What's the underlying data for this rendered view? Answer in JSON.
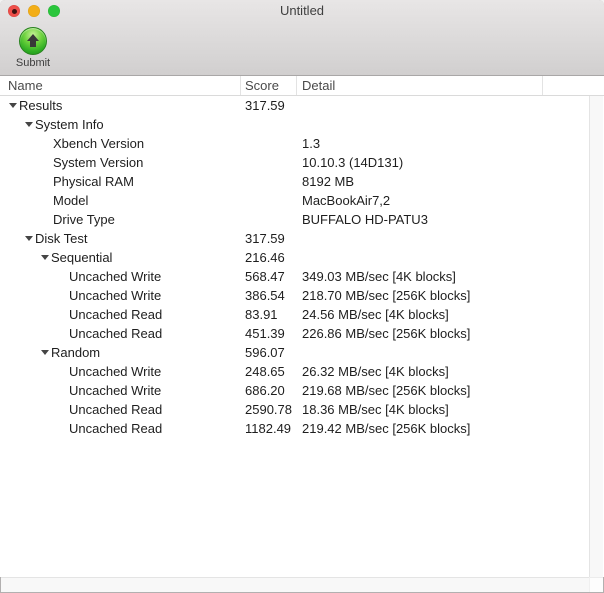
{
  "window": {
    "title": "Untitled",
    "icons": [
      "close-icon",
      "minimize-icon",
      "zoom-icon",
      "document-edited-dot",
      "submit-icon",
      "disclosure-triangle-icon"
    ]
  },
  "toolbar": {
    "submit_label": "Submit"
  },
  "table": {
    "columns": [
      {
        "label": "Name"
      },
      {
        "label": "Score"
      },
      {
        "label": "Detail"
      }
    ],
    "rows": [
      {
        "level": 0,
        "expandable": true,
        "name": "Results",
        "score": "317.59",
        "detail": ""
      },
      {
        "level": 1,
        "expandable": true,
        "name": "System Info",
        "score": "",
        "detail": ""
      },
      {
        "level": 2,
        "expandable": false,
        "name": "Xbench Version",
        "score": "",
        "detail": "1.3"
      },
      {
        "level": 2,
        "expandable": false,
        "name": "System Version",
        "score": "",
        "detail": "10.10.3 (14D131)"
      },
      {
        "level": 2,
        "expandable": false,
        "name": "Physical RAM",
        "score": "",
        "detail": "8192 MB"
      },
      {
        "level": 2,
        "expandable": false,
        "name": "Model",
        "score": "",
        "detail": "MacBookAir7,2"
      },
      {
        "level": 2,
        "expandable": false,
        "name": "Drive Type",
        "score": "",
        "detail": "BUFFALO HD-PATU3"
      },
      {
        "level": 1,
        "expandable": true,
        "name": "Disk Test",
        "score": "317.59",
        "detail": ""
      },
      {
        "level": 2,
        "expandable": true,
        "name": "Sequential",
        "score": "216.46",
        "detail": ""
      },
      {
        "level": 3,
        "expandable": false,
        "name": "Uncached Write",
        "score": "568.47",
        "detail": "349.03 MB/sec [4K blocks]"
      },
      {
        "level": 3,
        "expandable": false,
        "name": "Uncached Write",
        "score": "386.54",
        "detail": "218.70 MB/sec [256K blocks]"
      },
      {
        "level": 3,
        "expandable": false,
        "name": "Uncached Read",
        "score": "83.91",
        "detail": "24.56 MB/sec [4K blocks]"
      },
      {
        "level": 3,
        "expandable": false,
        "name": "Uncached Read",
        "score": "451.39",
        "detail": "226.86 MB/sec [256K blocks]"
      },
      {
        "level": 2,
        "expandable": true,
        "name": "Random",
        "score": "596.07",
        "detail": ""
      },
      {
        "level": 3,
        "expandable": false,
        "name": "Uncached Write",
        "score": "248.65",
        "detail": "26.32 MB/sec [4K blocks]"
      },
      {
        "level": 3,
        "expandable": false,
        "name": "Uncached Write",
        "score": "686.20",
        "detail": "219.68 MB/sec [256K blocks]"
      },
      {
        "level": 3,
        "expandable": false,
        "name": "Uncached Read",
        "score": "2590.78",
        "detail": "18.36 MB/sec [4K blocks]"
      },
      {
        "level": 3,
        "expandable": false,
        "name": "Uncached Read",
        "score": "1182.49",
        "detail": "219.42 MB/sec [256K blocks]"
      }
    ]
  },
  "colors": {
    "close-red": "#ee4e49",
    "edited-dot": "#3c1210",
    "minimize-yellow": "#f3ae17",
    "zoom-green": "#2ac63c",
    "submit-green": "#2fae23",
    "chrome-top": "#e8e6e6",
    "chrome-bottom": "#d1cfcf"
  }
}
